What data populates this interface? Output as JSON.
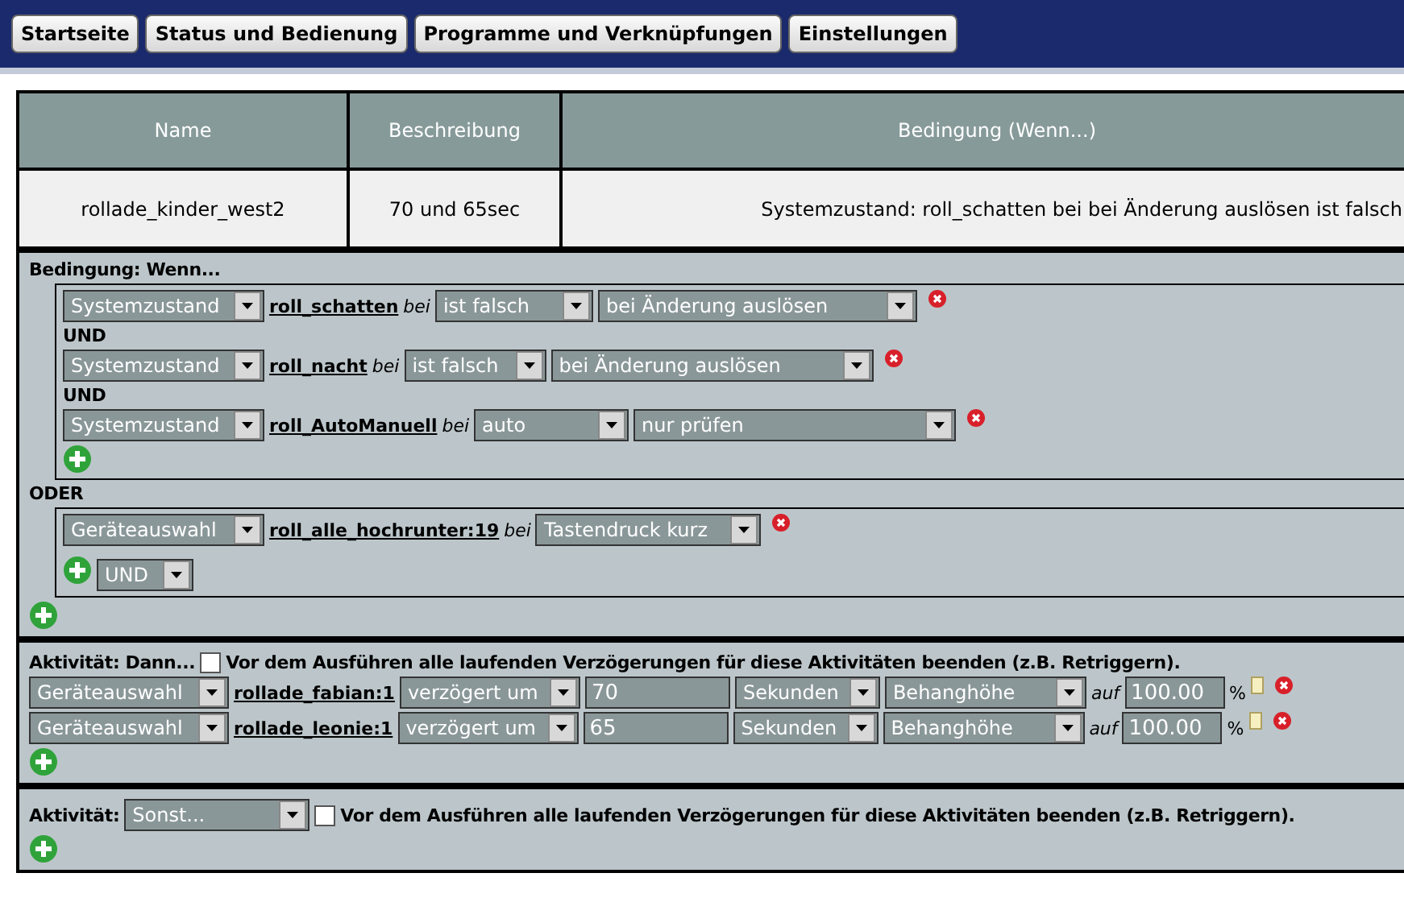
{
  "nav": [
    {
      "label": "Startseite"
    },
    {
      "label": "Status und Bedienung"
    },
    {
      "label": "Programme und Verknüpfungen"
    },
    {
      "label": "Einstellungen"
    }
  ],
  "table": {
    "columns": [
      "Name",
      "Beschreibung",
      "Bedingung (Wenn...)"
    ],
    "rows": [
      [
        "rollade_kinder_west2",
        "70 und 65sec",
        "Systemzustand: roll_schatten bei bei Änderung auslösen ist falsch"
      ]
    ]
  },
  "condition": {
    "title": "Bedingung: Wenn...",
    "groups": [
      {
        "conditions": [
          {
            "source": "Systemzustand",
            "name": "roll_schatten",
            "bei": "bei",
            "value": "ist falsch",
            "trigger": "bei Änderung auslösen"
          },
          {
            "joiner": "UND",
            "source": "Systemzustand",
            "name": "roll_nacht",
            "bei": "bei",
            "value": "ist falsch",
            "trigger": "bei Änderung auslösen"
          },
          {
            "joiner": "UND",
            "source": "Systemzustand",
            "name": "roll_AutoManuell",
            "bei": "bei",
            "value": "auto",
            "trigger": "nur prüfen"
          }
        ]
      },
      {
        "separator": "ODER",
        "conditions": [
          {
            "source": "Geräteauswahl",
            "name": "roll_alle_hochrunter:19",
            "bei": "bei",
            "value": "Tastendruck kurz"
          }
        ],
        "operator": "UND"
      }
    ]
  },
  "activities": [
    {
      "label": "Aktivität: Dann...",
      "checked": false,
      "checkbox_label": "Vor dem Ausführen alle laufenden Verzögerungen für diese Aktivitäten beenden (z.B. Retriggern).",
      "rows": [
        {
          "source": "Geräteauswahl",
          "name": "rollade_fabian:1",
          "mode": "verzögert um",
          "delay": "70",
          "unit": "Sekunden",
          "param": "Behanghöhe",
          "auf": "auf",
          "value": "100.00",
          "percent": "%"
        },
        {
          "source": "Geräteauswahl",
          "name": "rollade_leonie:1",
          "mode": "verzögert um",
          "delay": "65",
          "unit": "Sekunden",
          "param": "Behanghöhe",
          "auf": "auf",
          "value": "100.00",
          "percent": "%"
        }
      ]
    },
    {
      "label": "Aktivität:",
      "select": "Sonst...",
      "checked": false,
      "checkbox_label": "Vor dem Ausführen alle laufenden Verzögerungen für diese Aktivitäten beenden (z.B. Retriggern)."
    }
  ]
}
